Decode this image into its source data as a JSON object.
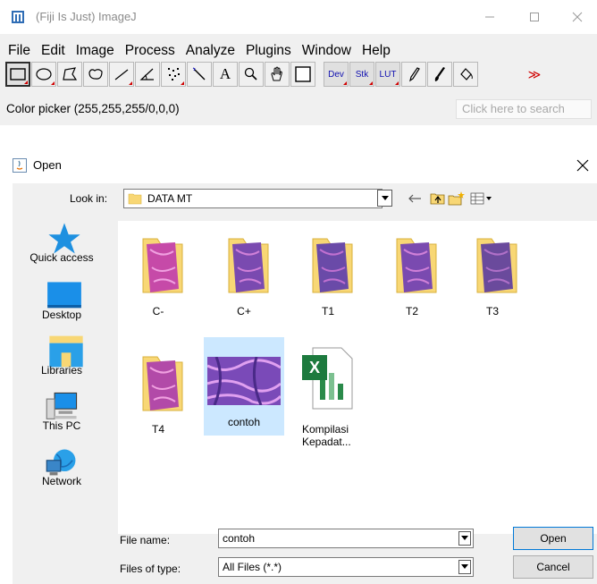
{
  "imagej": {
    "title": "(Fiji Is Just) ImageJ",
    "menu": [
      "File",
      "Edit",
      "Image",
      "Process",
      "Analyze",
      "Plugins",
      "Window",
      "Help"
    ],
    "tool_labels": {
      "dev": "Dev",
      "stk": "Stk",
      "lut": "LUT",
      "text_tool": "A",
      "more": "≫"
    },
    "status": "Color picker (255,255,255/0,0,0)",
    "search_placeholder": "Click here to search"
  },
  "dialog": {
    "title": "Open",
    "look_in_label": "Look in:",
    "look_in_value": "DATA MT",
    "places": [
      "Quick access",
      "Desktop",
      "Libraries",
      "This PC",
      "Network"
    ],
    "files": [
      {
        "name": "C-",
        "type": "folder",
        "color": "#c64aa8"
      },
      {
        "name": "C+",
        "type": "folder",
        "color": "#7a4ab0"
      },
      {
        "name": "T1",
        "type": "folder",
        "color": "#6a4aa8"
      },
      {
        "name": "T2",
        "type": "folder",
        "color": "#7a4ab0"
      },
      {
        "name": "T3",
        "type": "folder",
        "color": "#6a4a9c"
      },
      {
        "name": "T4",
        "type": "folder",
        "color": "#b24aa8"
      },
      {
        "name": "contoh",
        "type": "image",
        "color": "#7a4ab8"
      },
      {
        "name": "Kompilasi Kepadat...",
        "type": "excel",
        "color": "#1d7a3e"
      }
    ],
    "file_name_label": "File name:",
    "file_name_value": "contoh",
    "file_type_label": "Files of type:",
    "file_type_value": "All Files (*.*)",
    "open_label": "Open",
    "cancel_label": "Cancel"
  },
  "colors": {
    "accent": "#0078d7",
    "selection": "#cce8ff",
    "folder": "#f8d775"
  }
}
